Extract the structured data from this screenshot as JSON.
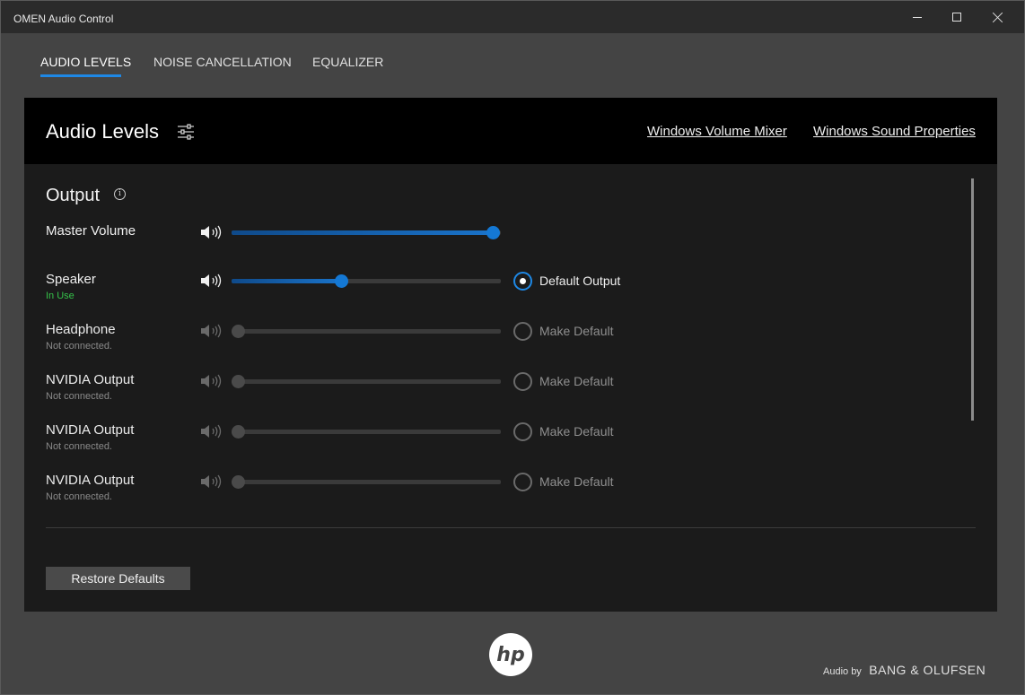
{
  "window": {
    "title": "OMEN Audio Control"
  },
  "tabs": [
    {
      "label": "AUDIO LEVELS",
      "active": true
    },
    {
      "label": "NOISE CANCELLATION",
      "active": false
    },
    {
      "label": "EQUALIZER",
      "active": false
    }
  ],
  "panel": {
    "title": "Audio Levels",
    "links": {
      "volume_mixer": "Windows Volume Mixer",
      "sound_properties": "Windows Sound Properties"
    },
    "output_heading": "Output",
    "info_glyph": "i",
    "rows": [
      {
        "name": "Master Volume",
        "status": "",
        "level": 0.97,
        "enabled": true,
        "radio_label": "",
        "selected": false
      },
      {
        "name": "Speaker",
        "status": "In Use",
        "level": 0.405,
        "enabled": true,
        "radio_label": "Default Output",
        "selected": true
      },
      {
        "name": "Headphone",
        "status": "Not connected.",
        "level": 0.0,
        "enabled": false,
        "radio_label": "Make Default",
        "selected": false
      },
      {
        "name": "NVIDIA Output",
        "status": "Not connected.",
        "level": 0.0,
        "enabled": false,
        "radio_label": "Make Default",
        "selected": false
      },
      {
        "name": "NVIDIA Output",
        "status": "Not connected.",
        "level": 0.0,
        "enabled": false,
        "radio_label": "Make Default",
        "selected": false
      },
      {
        "name": "NVIDIA Output",
        "status": "Not connected.",
        "level": 0.0,
        "enabled": false,
        "radio_label": "Make Default",
        "selected": false
      }
    ],
    "restore_label": "Restore Defaults"
  },
  "footer": {
    "logo_text": "hp",
    "audio_by_prefix": "Audio by",
    "audio_by_brand": "BANG & OLUFSEN"
  },
  "colors": {
    "accent": "#1e88e5",
    "in_use": "#35c14a"
  },
  "icons": [
    "sliders-icon",
    "info-icon",
    "speaker-icon",
    "hp-logo-icon",
    "minimize-icon",
    "maximize-icon",
    "close-icon"
  ]
}
